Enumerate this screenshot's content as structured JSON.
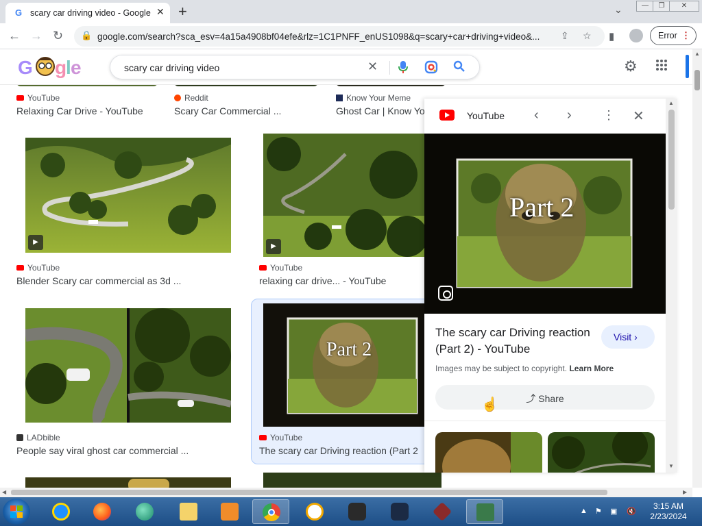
{
  "browser": {
    "tab_title": "scary car driving video - Google",
    "url": "google.com/search?sca_esv=4a15a4908bf04efe&rlz=1C1PNFF_enUS1098&q=scary+car+driving+video&...",
    "error_label": "Error"
  },
  "header": {
    "query": "scary car driving video"
  },
  "results": [
    {
      "source": "YouTube",
      "title": "Relaxing Car Drive - YouTube"
    },
    {
      "source": "Reddit",
      "title": "Scary Car Commercial ..."
    },
    {
      "source": "Know Your Meme",
      "title": "Ghost Car | Know Yo"
    },
    {
      "source": "YouTube",
      "title": "Blender Scary car commercial as 3d ..."
    },
    {
      "source": "YouTube",
      "title": "relaxing car drive... - YouTube"
    },
    {
      "source": "LADbible",
      "title": "People say viral ghost car commercial ..."
    },
    {
      "source": "YouTube",
      "title": "The scary car Driving reaction (Part 2"
    }
  ],
  "panel": {
    "source": "YouTube",
    "title": "The scary car Driving reaction (Part 2) - YouTube",
    "visit_label": "Visit",
    "copyright": "Images may be subject to copyright.",
    "learn_more": "Learn More",
    "share_label": "Share",
    "image_caption": "Part 2"
  },
  "thumb_caption": "Part 2",
  "taskbar": {
    "time": "3:15 AM",
    "date": "2/23/2024"
  },
  "colors": {
    "google_blue": "#4285f4",
    "youtube_red": "#ff0000",
    "link_blue": "#1a0dab",
    "selection_bg": "#e8f0fe"
  }
}
